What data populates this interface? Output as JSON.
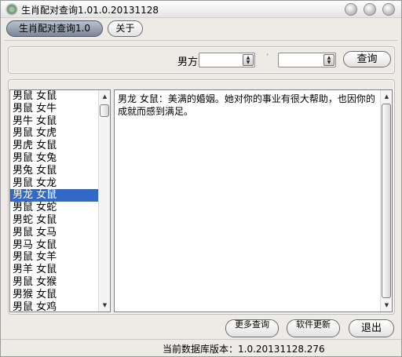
{
  "window": {
    "title": "生肖配对查询1.01.0.20131128"
  },
  "tabs": {
    "main_label": "生肖配对查询1.0",
    "about_label": "关于"
  },
  "query": {
    "male_label": "男方",
    "female_label": "女",
    "male_value": "",
    "female_value": "",
    "button_label": "查询"
  },
  "list": {
    "items": [
      "男鼠 女鼠",
      "男鼠 女牛",
      "男牛 女鼠",
      "男鼠 女虎",
      "男虎 女鼠",
      "男鼠 女兔",
      "男兔 女鼠",
      "男鼠 女龙",
      "男龙 女鼠",
      "男鼠 女蛇",
      "男蛇 女鼠",
      "男鼠 女马",
      "男马 女鼠",
      "男鼠 女羊",
      "男羊 女鼠",
      "男鼠 女猴",
      "男猴 女鼠",
      "男鼠 女鸡"
    ],
    "selected_index": 8
  },
  "result": {
    "text": "男龙 女鼠：美满的婚姻。她对你的事业有很大帮助，也因你的成就而感到满足。"
  },
  "footer": {
    "more_label": "更多查询",
    "update_label": "软件更新",
    "exit_label": "退出",
    "status_text": "当前数据库版本：1.0.20131128.276"
  },
  "icons": {
    "app": "gear-icon",
    "minimize": "minimize-icon",
    "maximize": "maximize-icon",
    "close": "close-icon"
  }
}
